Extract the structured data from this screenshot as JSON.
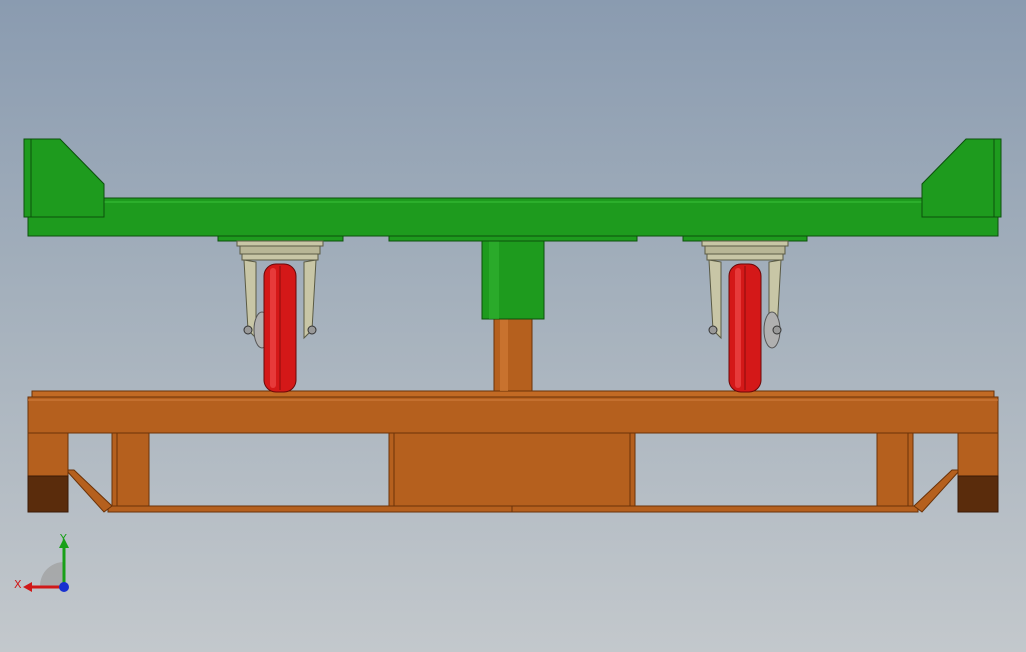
{
  "viewport": {
    "colors": {
      "bg_top": "#8a9bb0",
      "bg_bottom": "#c3c8cc",
      "frame_green": "#1e9b1e",
      "frame_green_dark": "#137013",
      "base_orange": "#b5601e",
      "base_orange_dark": "#7a3a10",
      "foot_brown": "#5a2c0c",
      "wheel_red": "#d41818",
      "caster_khaki": "#c8c6a6"
    }
  },
  "triad": {
    "x_label": "X",
    "y_label": "Y",
    "x_color": "#d01818",
    "y_color": "#18a018",
    "z_color": "#1830d0"
  }
}
